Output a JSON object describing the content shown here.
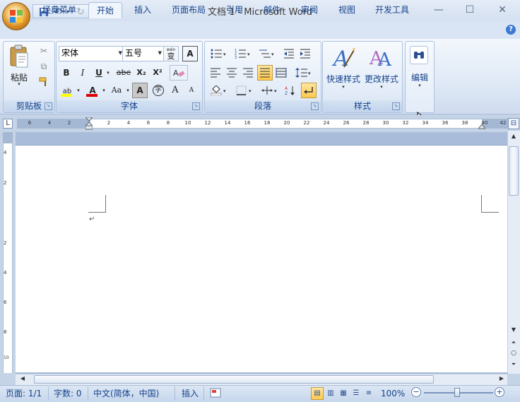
{
  "window": {
    "title": "文档 1 - Microsoft Word",
    "minimize": "—",
    "maximize": "☐",
    "close": "✕"
  },
  "qat": {
    "save": "💾",
    "undo": "↶",
    "redo": "↻",
    "customize": "▾"
  },
  "tabs": [
    "经典菜单",
    "开始",
    "插入",
    "页面布局",
    "引用",
    "邮件",
    "审阅",
    "视图",
    "开发工具"
  ],
  "active_tab": "开始",
  "help": "?",
  "ribbon": {
    "clipboard": {
      "label": "剪贴板",
      "paste": "粘贴"
    },
    "font": {
      "label": "字体",
      "font_name": "宋体",
      "font_size": "五号",
      "wen": "wén",
      "wen_char": "变",
      "char_border": "A",
      "bold": "B",
      "italic": "I",
      "underline": "U",
      "strike": "abe",
      "subscript": "X₂",
      "superscript": "X²",
      "clear": "A",
      "highlight": "ab",
      "font_color": "A",
      "change_case": "Aa",
      "char_shade": "A",
      "enclose": "字",
      "grow": "A",
      "shrink": "A"
    },
    "paragraph": {
      "label": "段落"
    },
    "styles": {
      "label": "样式",
      "quick": "快速样式",
      "change": "更改样式"
    },
    "editing": {
      "label": "编辑"
    }
  },
  "ruler": {
    "corner": "L",
    "h_numbers": [
      "6",
      "4",
      "2",
      "2",
      "4",
      "6",
      "8",
      "10",
      "12",
      "14",
      "16",
      "18",
      "20",
      "22",
      "24",
      "26",
      "28",
      "30",
      "32",
      "34",
      "36",
      "38",
      "40",
      "42"
    ],
    "v_numbers": [
      "4",
      "2",
      "2",
      "4",
      "6",
      "8",
      "10"
    ]
  },
  "document": {
    "paragraph_mark": "↵"
  },
  "statusbar": {
    "page": "页面: 1/1",
    "words": "字数: 0",
    "language": "中文(简体，中国)",
    "insert": "插入",
    "zoom": "100%",
    "zoom_minus": "−",
    "zoom_plus": "+"
  },
  "colors": {
    "accent": "#15428b",
    "ribbon": "#dfe9f6",
    "selected": "#ffc94d",
    "font_color": "#e00000",
    "highlight": "#ffff00"
  }
}
